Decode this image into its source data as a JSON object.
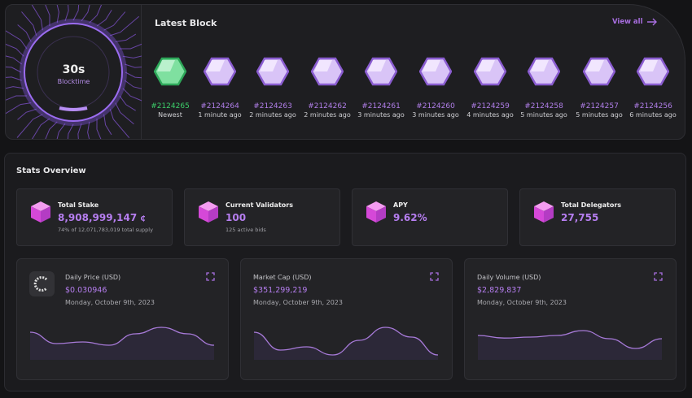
{
  "blocktime": {
    "value": "30s",
    "label": "Blocktime"
  },
  "latest_block": {
    "title": "Latest Block",
    "view_all": "View all",
    "blocks": [
      {
        "number": "#2124265",
        "time": "Newest",
        "newest": true
      },
      {
        "number": "#2124264",
        "time": "1 minute ago"
      },
      {
        "number": "#2124263",
        "time": "2 minutes ago"
      },
      {
        "number": "#2124262",
        "time": "2 minutes ago"
      },
      {
        "number": "#2124261",
        "time": "3 minutes ago"
      },
      {
        "number": "#2124260",
        "time": "3 minutes ago"
      },
      {
        "number": "#2124259",
        "time": "4 minutes ago"
      },
      {
        "number": "#2124258",
        "time": "5 minutes ago"
      },
      {
        "number": "#2124257",
        "time": "5 minutes ago"
      },
      {
        "number": "#2124256",
        "time": "6 minutes ago"
      }
    ]
  },
  "stats": {
    "title": "Stats Overview",
    "cards": [
      {
        "label": "Total Stake",
        "value": "8,908,999,147",
        "unit": "₵",
        "sub": "74% of 12,071,783,019 total supply"
      },
      {
        "label": "Current Validators",
        "value": "100",
        "sub": "125 active bids"
      },
      {
        "label": "APY",
        "value": "9.62%"
      },
      {
        "label": "Total Delegators",
        "value": "27,755"
      }
    ],
    "charts": [
      {
        "label": "Daily Price (USD)",
        "value": "$0.030946",
        "date": "Monday, October 9th, 2023",
        "series": [
          0.8,
          0.45,
          0.5,
          0.4,
          0.75,
          0.95,
          0.75,
          0.4
        ]
      },
      {
        "label": "Market Cap (USD)",
        "value": "$351,299,219",
        "date": "Monday, October 9th, 2023",
        "series": [
          0.8,
          0.25,
          0.35,
          0.1,
          0.55,
          0.95,
          0.65,
          0.1
        ]
      },
      {
        "label": "Daily Volume (USD)",
        "value": "$2,829,837",
        "date": "Monday, October 9th, 2023",
        "series": [
          0.7,
          0.62,
          0.65,
          0.7,
          0.85,
          0.6,
          0.3,
          0.6
        ]
      }
    ]
  },
  "colors": {
    "accent": "#b67ef0",
    "newest": "#3ccf6a",
    "bg": "#141416"
  }
}
